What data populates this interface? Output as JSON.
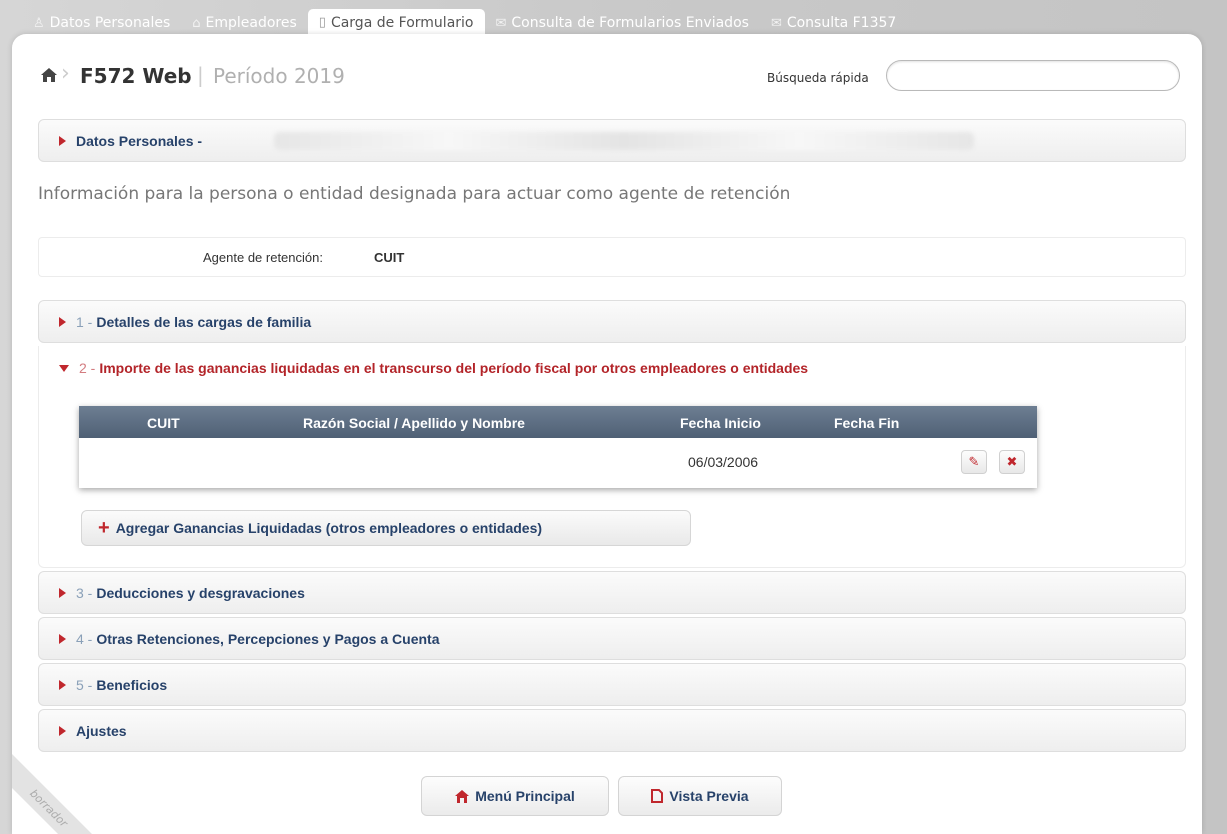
{
  "tabs": [
    {
      "label": "Datos Personales",
      "icon": "user-icon"
    },
    {
      "label": "Empleadores",
      "icon": "building-icon"
    },
    {
      "label": "Carga de Formulario",
      "icon": "document-icon",
      "active": true
    },
    {
      "label": "Consulta de Formularios Enviados",
      "icon": "envelope-icon"
    },
    {
      "label": "Consulta F1357",
      "icon": "envelope-icon"
    }
  ],
  "header": {
    "title": "F572 Web",
    "separator": "|",
    "period": "Período 2019",
    "search_label": "Búsqueda rápida",
    "search_value": ""
  },
  "personal": {
    "label": "Datos Personales -"
  },
  "info_text": "Información para la persona o entidad designada para actuar como agente de retención",
  "agent": {
    "label": "Agente de retención:",
    "value": "CUIT"
  },
  "sections": {
    "s1": {
      "num": "1 -",
      "label": "Detalles de las cargas de familia"
    },
    "s2": {
      "num": "2 -",
      "label": "Importe de las ganancias liquidadas en el transcurso del período fiscal por otros empleadores o entidades"
    },
    "s3": {
      "num": "3 -",
      "label": "Deducciones y desgravaciones"
    },
    "s4": {
      "num": "4 -",
      "label": "Otras Retenciones, Percepciones y Pagos a Cuenta"
    },
    "s5": {
      "num": "5 -",
      "label": "Beneficios"
    },
    "ajustes": {
      "label": "Ajustes"
    }
  },
  "table": {
    "columns": [
      "CUIT",
      "Razón Social / Apellido y Nombre",
      "Fecha Inicio",
      "Fecha Fin"
    ],
    "rows": [
      {
        "cuit": "",
        "razon": "",
        "fecha_inicio": "06/03/2006",
        "fecha_fin": ""
      }
    ]
  },
  "add_button": {
    "label": "Agregar Ganancias Liquidadas (otros empleadores o entidades)"
  },
  "footer": {
    "menu_label": "Menú Principal",
    "preview_label": "Vista Previa"
  },
  "watermark": "borrador",
  "colors": {
    "accent": "#c0272d",
    "label": "#27426a",
    "table_header": "#5a6b80"
  }
}
